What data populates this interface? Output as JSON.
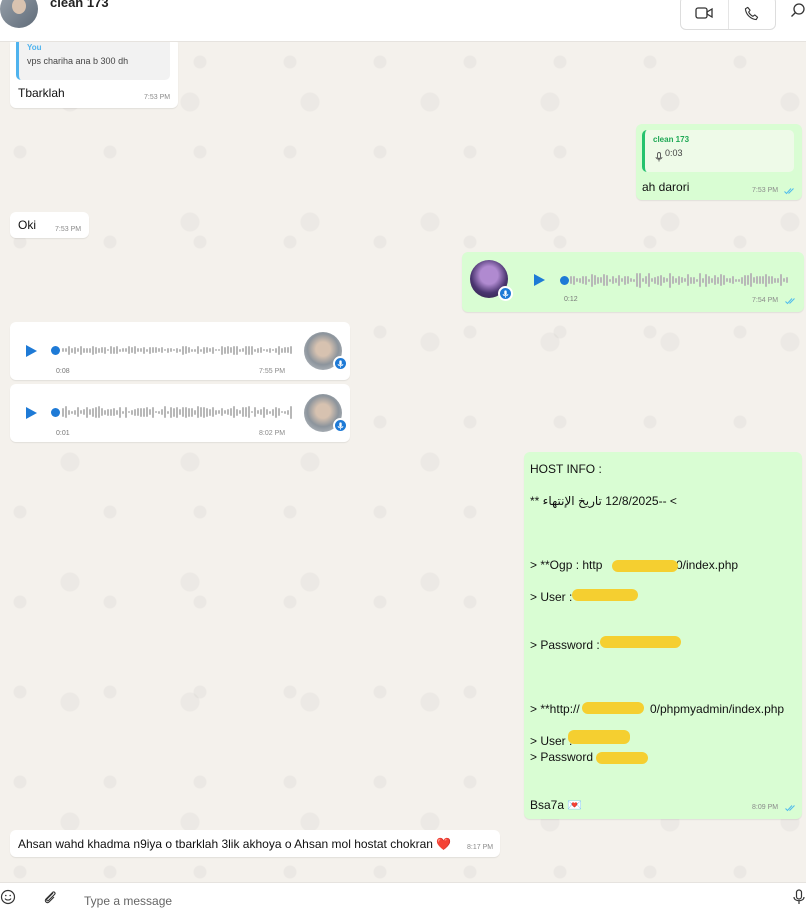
{
  "header": {
    "contact_name": "clean 173",
    "icons": [
      "video-icon",
      "phone-icon",
      "search-icon"
    ]
  },
  "colors": {
    "outgoing_bubble": "#d9fdd3",
    "incoming_bubble": "#ffffff",
    "accent_blue": "#1e7ad6",
    "read_ticks": "#53bdeb",
    "redaction": "#f5cf30"
  },
  "messages": {
    "m1": {
      "quote_name": "You",
      "quote_text": "vps chariha ana b 300 dh",
      "text": "Tbarklah",
      "time": "7:53 PM"
    },
    "m2": {
      "quote_name": "clean 173",
      "quote_duration": "0:03",
      "text": "ah darori",
      "time": "7:53 PM"
    },
    "m3": {
      "text": "Oki",
      "time": "7:53 PM"
    },
    "m4": {
      "duration": "0:12",
      "time": "7:54 PM"
    },
    "m5": {
      "duration": "0:08",
      "time": "7:55 PM"
    },
    "m6": {
      "duration": "0:01",
      "time": "8:02 PM"
    },
    "m7": {
      "lines": {
        "l1": "HOST INFO :",
        "l2": "> --12/8/2025 تاريخ الإنتهاء **",
        "l3": "> **Ogp : http",
        "l3b": "0/index.php",
        "l4": "> User :",
        "l5": "> Password :",
        "l6": "> **http://",
        "l6b": "0/phpmyadmin/index.php",
        "l7": "> User :",
        "l8": "> Password :",
        "l9": "Bsa7a 💌"
      },
      "time": "8:09 PM"
    },
    "m8": {
      "text": "Ahsan wahd khadma n9iya o tbarklah 3lik akhoya o Ahsan mol hostat chokran ❤️",
      "time": "8:17 PM"
    }
  },
  "composer": {
    "placeholder": "Type a message"
  }
}
